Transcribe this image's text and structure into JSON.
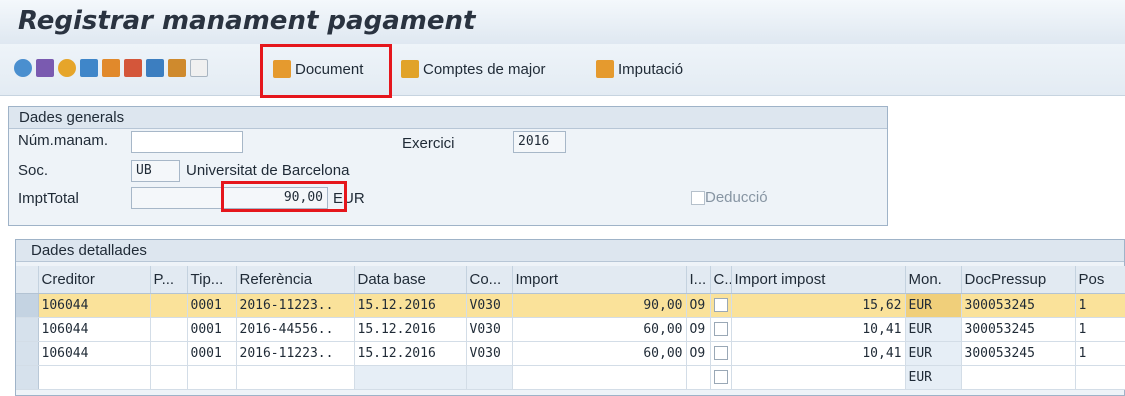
{
  "window": {
    "title": "Registrar manament pagament"
  },
  "toolbar": {
    "document_label": "Document",
    "comptes_label": "Comptes de major",
    "imputacio_label": "Imputació"
  },
  "general": {
    "section_title": "Dades generals",
    "num_label": "Núm.manam.",
    "num_value": "",
    "exercici_label": "Exercici",
    "exercici_value": "2016",
    "soc_label": "Soc.",
    "soc_value": "UB",
    "soc_desc": "Universitat de Barcelona",
    "impt_label": "ImptTotal",
    "impt_value": "90,00",
    "currency": "EUR",
    "deduccio_label": "Deducció"
  },
  "detail": {
    "section_title": "Dades detallades",
    "columns": [
      "Creditor",
      "P...",
      "Tip...",
      "Referència",
      "Data base",
      "Co...",
      "Import",
      "I...",
      "C..",
      "Import impost",
      "Mon.",
      "DocPressup",
      "Pos"
    ],
    "rows": [
      [
        "106044",
        "",
        "0001",
        "2016-11223..",
        "15.12.2016",
        "V030",
        "90,00",
        "O9",
        "",
        "15,62",
        "EUR",
        "300053245",
        "1"
      ],
      [
        "106044",
        "",
        "0001",
        "2016-44556..",
        "15.12.2016",
        "V030",
        "60,00",
        "O9",
        "",
        "10,41",
        "EUR",
        "300053245",
        "1"
      ],
      [
        "106044",
        "",
        "0001",
        "2016-11223..",
        "15.12.2016",
        "V030",
        "60,00",
        "O9",
        "",
        "10,41",
        "EUR",
        "300053245",
        "1"
      ],
      [
        "",
        "",
        "",
        "",
        "",
        "",
        "",
        "",
        "",
        "",
        "EUR",
        "",
        ""
      ]
    ]
  },
  "colors": {
    "highlight": "#e5161c",
    "selected_row": "#fae29a"
  }
}
